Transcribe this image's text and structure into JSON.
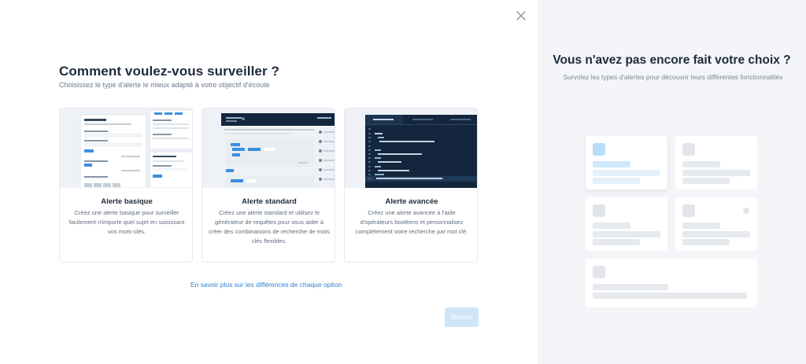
{
  "modal": {
    "title": "Comment voulez-vous surveiller ?",
    "subtitle": "Choisissez le type d'alerte le mieux adapté à votre objectif d'écoute",
    "learn_more_link": "En savoir plus sur les différences de chaque option",
    "next_button": "Suivant",
    "close_icon": "close-icon"
  },
  "options": [
    {
      "name": "Alerte basique",
      "description": "Créez une alerte basique pour surveiller facilement n'importe quel sujet en saisissant vos mots-clés."
    },
    {
      "name": "Alerte standard",
      "description": "Créez une alerte standard et utilisez le générateur de requêtes pour vous aider à créer des combinaisons de recherche de mots clés flexibles."
    },
    {
      "name": "Alerte avancée",
      "description": "Créez une alerte avancée à l'aide d'opérateurs booléens et personnalisez complètement votre recherche par mot clé."
    }
  ],
  "side_panel": {
    "title": "Vous n'avez pas encore fait votre choix ?",
    "subtitle": "Survolez les types d'alertes pour découvrir leurs différentes fonctionnalités"
  },
  "colors": {
    "accent": "#2f7fd0",
    "next_button_disabled": "#cfe6f9",
    "side_panel_bg": "#f3f5f8",
    "code_bg": "#13263d"
  }
}
